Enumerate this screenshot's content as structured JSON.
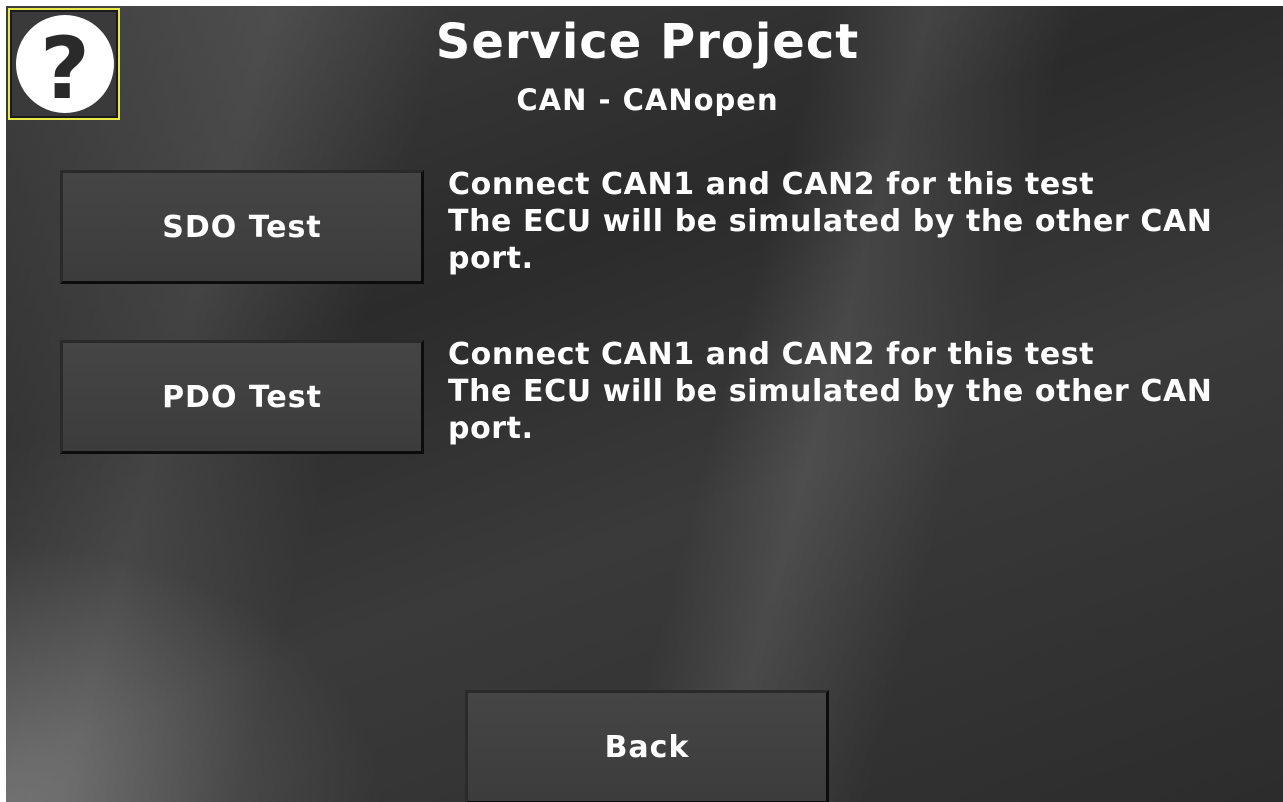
{
  "header": {
    "title": "Service Project",
    "subtitle": "CAN - CANopen"
  },
  "help_button": {
    "icon": "question-mark-icon",
    "symbol": "?"
  },
  "tests": [
    {
      "label": "SDO Test",
      "description": [
        "Connect CAN1 and CAN2 for this test",
        "The ECU will be simulated by the other CAN",
        "port."
      ]
    },
    {
      "label": "PDO Test",
      "description": [
        "Connect CAN1 and CAN2 for this test",
        "The ECU will be simulated by the other CAN",
        "port."
      ]
    }
  ],
  "footer": {
    "back_label": "Back"
  },
  "colors": {
    "background": "#333333",
    "text": "#ffffff",
    "help_border": "#e8e84a"
  }
}
